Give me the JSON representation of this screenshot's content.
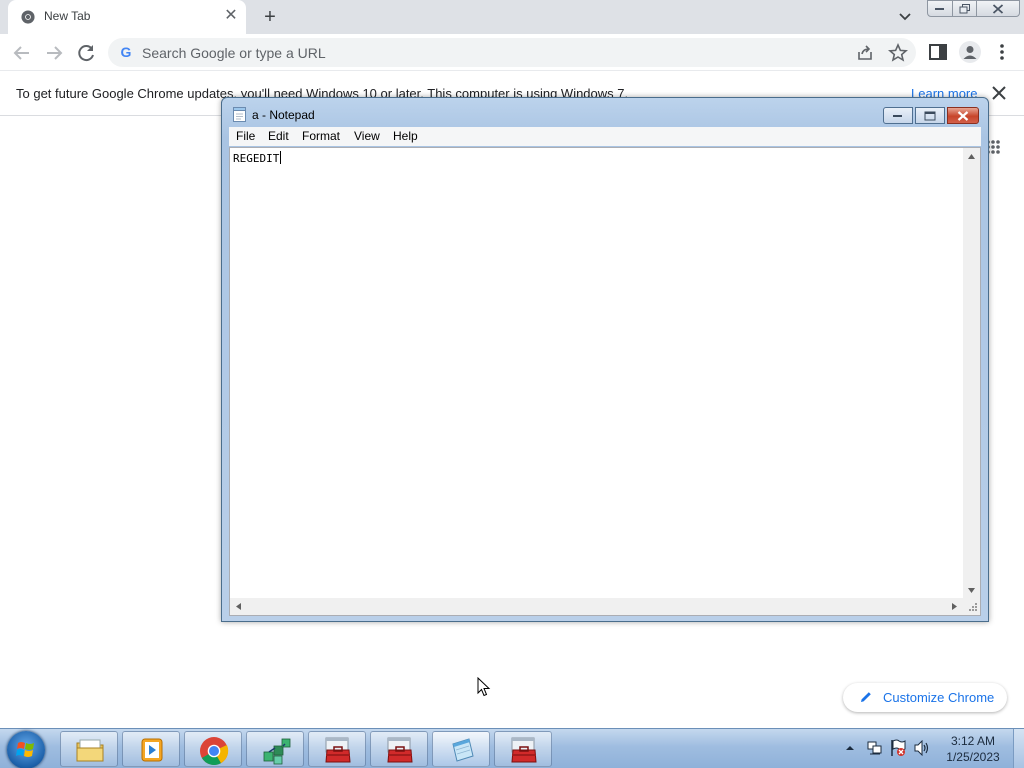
{
  "chrome": {
    "tab_title": "New Tab",
    "tab_favicon": "chrome-logo-icon",
    "omnibox_placeholder": "Search Google or type a URL",
    "infobar_text": "To get future Google Chrome updates, you'll need Windows 10 or later. This computer is using Windows 7.",
    "infobar_link": "Learn more",
    "customize_label": "Customize Chrome",
    "colors": {
      "tabstrip": "#dee1e6",
      "link": "#1a73e8",
      "omnibox_bg": "#f1f3f4"
    }
  },
  "notepad": {
    "title": "a - Notepad",
    "menu": [
      "File",
      "Edit",
      "Format",
      "View",
      "Help"
    ],
    "content": "REGEDIT",
    "colors": {
      "frame": "#a9c4e3",
      "close": "#c7452b"
    }
  },
  "taskbar": {
    "items": [
      {
        "name": "windows-explorer",
        "icon": "folder-icon"
      },
      {
        "name": "media-player",
        "icon": "media-player-icon"
      },
      {
        "name": "google-chrome",
        "icon": "chrome-icon"
      },
      {
        "name": "network-app",
        "icon": "network-cubes-icon"
      },
      {
        "name": "toolbox-app-1",
        "icon": "toolbox-icon"
      },
      {
        "name": "toolbox-app-2",
        "icon": "toolbox-icon"
      },
      {
        "name": "notepad",
        "icon": "notepad-icon"
      },
      {
        "name": "toolbox-app-3",
        "icon": "toolbox-icon"
      }
    ],
    "clock_time": "3:12 AM",
    "clock_date": "1/25/2023"
  }
}
